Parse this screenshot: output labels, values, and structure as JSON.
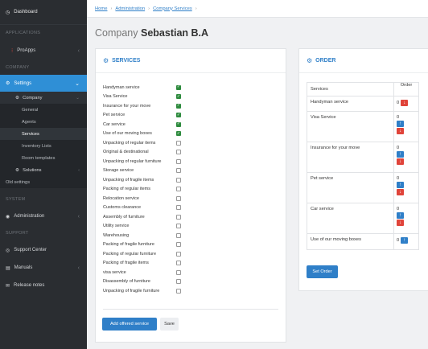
{
  "sidebar": {
    "dashboard": "Dashboard",
    "sec_applications": "APPLICATIONS",
    "proapps": "ProApps",
    "sec_company": "COMPANY",
    "settings": "Settings",
    "company": "Company",
    "sub_items": [
      "General",
      "Agents",
      "Services",
      "Inventory Lists",
      "Room templates"
    ],
    "solutions": "Solutions",
    "old_settings": "Old settings",
    "sec_system": "SYSTEM",
    "administration": "Administration",
    "sec_support": "SUPPORT",
    "support_center": "Support Center",
    "manuals": "Manuals",
    "release_notes": "Release notes"
  },
  "breadcrumb": [
    "Home",
    "Administration",
    "Company Services"
  ],
  "page_title": {
    "prefix": "Company",
    "name": "Sebastian B.A"
  },
  "services_card": {
    "title": "SERVICES",
    "items": [
      {
        "label": "Handyman service",
        "checked": true
      },
      {
        "label": "Visa Service",
        "checked": true
      },
      {
        "label": "Insurance for your move",
        "checked": true
      },
      {
        "label": "Pet service",
        "checked": true
      },
      {
        "label": "Car service",
        "checked": true
      },
      {
        "label": "Use of our moving boxes",
        "checked": true
      },
      {
        "label": "Unpacking of regular items",
        "checked": false
      },
      {
        "label": "Original & destinational",
        "checked": false
      },
      {
        "label": "Unpacking of regular furniture",
        "checked": false
      },
      {
        "label": "Storage service",
        "checked": false
      },
      {
        "label": "Unpacking of fragile items",
        "checked": false
      },
      {
        "label": "Packing of regular items",
        "checked": false
      },
      {
        "label": "Relocation service",
        "checked": false
      },
      {
        "label": "Customs clearance",
        "checked": false
      },
      {
        "label": "Assembly of furniture",
        "checked": false
      },
      {
        "label": "Utility service",
        "checked": false
      },
      {
        "label": "Warehousing",
        "checked": false
      },
      {
        "label": "Packing of fragile furniture",
        "checked": false
      },
      {
        "label": "Packing of regular furniture",
        "checked": false
      },
      {
        "label": "Packing of fragile items",
        "checked": false
      },
      {
        "label": "visa service",
        "checked": false
      },
      {
        "label": "Disassembly of furniture",
        "checked": false
      },
      {
        "label": "Unpacking of fragile furniture",
        "checked": false
      }
    ],
    "add_button": "Add offered service",
    "save_button": "Save"
  },
  "order_card": {
    "title": "ORDER",
    "col_services": "Services",
    "col_order": "Order",
    "rows": [
      {
        "service": "Handyman service",
        "order": "0",
        "controls": "down-inline"
      },
      {
        "service": "Visa Service",
        "order": "0",
        "controls": "both"
      },
      {
        "service": "Insurance for your move",
        "order": "0",
        "controls": "both"
      },
      {
        "service": "Pet service",
        "order": "0",
        "controls": "both"
      },
      {
        "service": "Car service",
        "order": "0",
        "controls": "both"
      },
      {
        "service": "Use of our moving boxes",
        "order": "0",
        "controls": "up-inline"
      }
    ],
    "set_order_button": "Set Order"
  },
  "colors": {
    "accent": "#2f7fc8",
    "sidebar_bg": "#2a2d31",
    "active": "#2f8fd6",
    "check": "#2e8b3e",
    "down": "#e0443a"
  }
}
